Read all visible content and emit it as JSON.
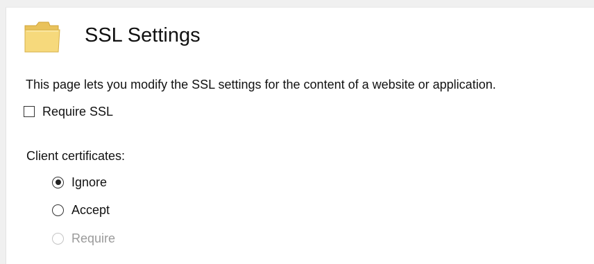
{
  "header": {
    "title": "SSL Settings",
    "icon": "folder-icon"
  },
  "description": "This page lets you modify the SSL settings for the content of a website or application.",
  "require_ssl": {
    "label": "Require SSL",
    "checked": false
  },
  "client_certificates": {
    "label": "Client certificates:",
    "options": [
      {
        "label": "Ignore",
        "selected": true,
        "enabled": true
      },
      {
        "label": "Accept",
        "selected": false,
        "enabled": true
      },
      {
        "label": "Require",
        "selected": false,
        "enabled": false
      }
    ]
  },
  "colors": {
    "folder_fill": "#f5d87a",
    "folder_edge": "#d9b548",
    "disabled_text": "#9a9a9a"
  }
}
